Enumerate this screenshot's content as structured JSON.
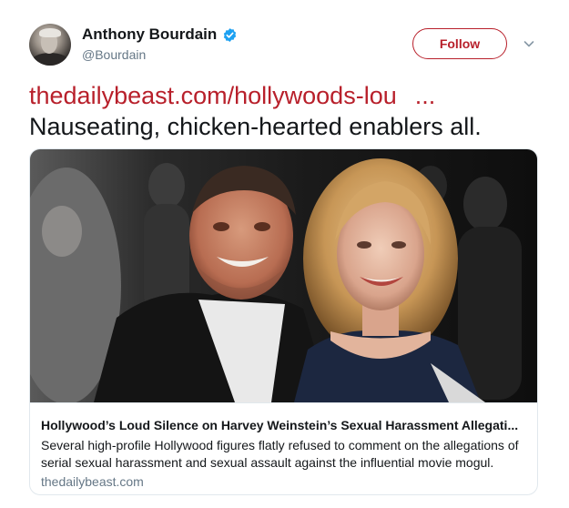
{
  "author": {
    "display_name": "Anthony Bourdain",
    "handle": "@Bourdain",
    "verified": true,
    "avatar_icon": "profile-photo"
  },
  "actions": {
    "follow_label": "Follow",
    "more_icon": "chevron-down-icon"
  },
  "tweet": {
    "link_text": "thedailybeast.com/hollywoods-lou",
    "link_ellipsis": "...",
    "text": "Nauseating, chicken-hearted enablers all."
  },
  "card": {
    "image_icon": "photo-of-harvey-weinstein-and-meryl-streep",
    "title": "Hollywood’s Loud Silence on Harvey Weinstein’s Sexual Harassment Allegati...",
    "description": "Several high-profile Hollywood figures flatly refused to comment on the allegations of serial sexual harassment and sexual assault against the influential movie mogul.",
    "domain": "thedailybeast.com"
  },
  "colors": {
    "accent": "#b8202b",
    "verified_blue": "#1da1f2",
    "secondary_text": "#657786",
    "border": "#e1e8ed"
  }
}
